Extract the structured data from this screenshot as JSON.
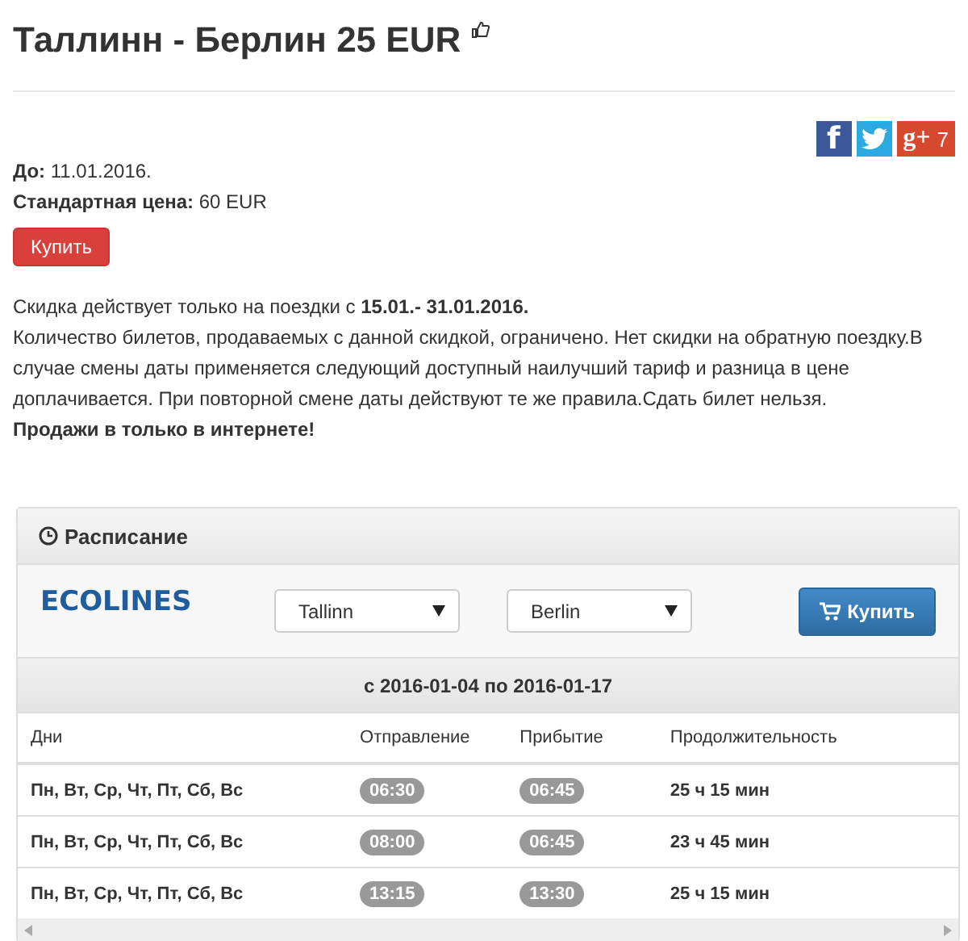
{
  "title": "Таллинн - Берлин 25 EUR",
  "share": {
    "facebook": "f",
    "google": "g+",
    "google_count": "7"
  },
  "details": [
    {
      "label": "До:",
      "value": "11.01.2016."
    },
    {
      "label": "Стандартная цена:",
      "value": "60 EUR"
    }
  ],
  "buy_button": "Купить",
  "description": [
    "Скидка действует только на поездки с **15.01.- 31.01.2016.**",
    "Количество билетов, продаваемых с данной скидкой, ограничено. Нет скидки на обратную поездку.В случае смены даты применяется следующий доступный наилучший тариф и разница в цене доплачивается. При повторной смене даты действуют те же правила.Сдать билет нельзя.",
    "**Продажи в только в интернете!**"
  ],
  "schedule": {
    "title": "Расписание",
    "logo": "ECOLINES",
    "from": "Tallinn",
    "to": "Berlin",
    "buy_button": "Купить",
    "period": "с 2016-01-04 по 2016-01-17",
    "columns": [
      "Дни",
      "Отправление",
      "Прибытие",
      "Продолжительность"
    ],
    "rows": [
      {
        "days": "Пн, Вт, Ср, Чт, Пт, Сб, Вс",
        "departure": "06:30",
        "arrival": "06:45",
        "duration": "25 ч 15 мин"
      },
      {
        "days": "Пн, Вт, Ср, Чт, Пт, Сб, Вс",
        "departure": "08:00",
        "arrival": "06:45",
        "duration": "23 ч 45 мин"
      },
      {
        "days": "Пн, Вт, Ср, Чт, Пт, Сб, Вс",
        "departure": "13:15",
        "arrival": "13:30",
        "duration": "25 ч 15 мин"
      }
    ]
  }
}
